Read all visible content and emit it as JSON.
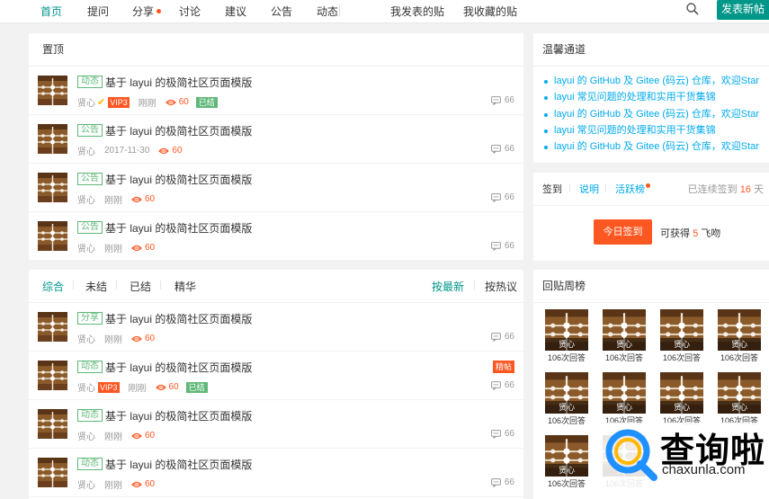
{
  "nav": {
    "items": [
      {
        "label": "首页",
        "active": true
      },
      {
        "label": "提问"
      },
      {
        "label": "分享",
        "dot": true
      },
      {
        "label": "讨论"
      },
      {
        "label": "建议"
      },
      {
        "label": "公告"
      },
      {
        "label": "动态"
      },
      {
        "label": "我发表的贴"
      },
      {
        "label": "我收藏的贴"
      }
    ],
    "search_icon": "search-icon",
    "post_button": "发表新帖"
  },
  "sticky_panel": {
    "title": "置顶",
    "posts": [
      {
        "tag": "动态",
        "title": "基于 layui 的极简社区页面模版",
        "author": "贤心",
        "verified": true,
        "vip": "VIP3",
        "time": "刚刚",
        "kiss": "60",
        "done": "已结",
        "replies": "66"
      },
      {
        "tag": "公告",
        "title": "基于 layui 的极简社区页面模版",
        "author": "贤心",
        "time": "2017-11-30",
        "kiss": "60",
        "replies": "66"
      },
      {
        "tag": "公告",
        "title": "基于 layui 的极简社区页面模版",
        "author": "贤心",
        "time": "刚刚",
        "kiss": "60",
        "replies": "66"
      },
      {
        "tag": "公告",
        "title": "基于 layui 的极简社区页面模版",
        "author": "贤心",
        "time": "刚刚",
        "kiss": "60",
        "replies": "66"
      }
    ]
  },
  "list_panel": {
    "filters": [
      "综合",
      "未结",
      "已结",
      "精华"
    ],
    "sorts": [
      "按最新",
      "按热议"
    ],
    "posts": [
      {
        "tag": "分享",
        "title": "基于 layui 的极简社区页面模版",
        "author": "贤心",
        "time": "刚刚",
        "kiss": "60",
        "replies": "66"
      },
      {
        "tag": "动态",
        "title": "基于 layui 的极简社区页面模版",
        "author": "贤心",
        "vip": "VIP3",
        "time": "刚刚",
        "kiss": "60",
        "done": "已结",
        "sticky": "精帖",
        "replies": "66"
      },
      {
        "tag": "动态",
        "title": "基于 layui 的极简社区页面模版",
        "author": "贤心",
        "time": "刚刚",
        "kiss": "60",
        "replies": "66"
      },
      {
        "tag": "动态",
        "title": "基于 layui 的极简社区页面模版",
        "author": "贤心",
        "time": "刚刚",
        "kiss": "60",
        "replies": "66"
      }
    ]
  },
  "links_panel": {
    "title": "温馨通道",
    "links": [
      "layui 的 GitHub 及 Gitee (码云) 仓库，欢迎Star",
      "layui 常见问题的处理和实用干货集锦",
      "layui 的 GitHub 及 Gitee (码云) 仓库，欢迎Star",
      "layui 常见问题的处理和实用干货集锦",
      "layui 的 GitHub 及 Gitee (码云) 仓库，欢迎Star"
    ]
  },
  "sign_panel": {
    "tabs": [
      "签到",
      "说明",
      "活跃榜"
    ],
    "streak_prefix": "已连续签到",
    "streak_days": "16",
    "streak_suffix": "天",
    "button": "今日签到",
    "reward_prefix": "可获得",
    "reward_amount": "5",
    "reward_suffix": "飞吻"
  },
  "rank_panel": {
    "title": "回贴周榜",
    "users": [
      {
        "name": "贤心",
        "count": "106次回答"
      },
      {
        "name": "贤心",
        "count": "106次回答"
      },
      {
        "name": "贤心",
        "count": "106次回答"
      },
      {
        "name": "贤心",
        "count": "106次回答"
      },
      {
        "name": "贤心",
        "count": "106次回答"
      },
      {
        "name": "贤心",
        "count": "106次回答"
      },
      {
        "name": "贤心",
        "count": "106次回答"
      },
      {
        "name": "贤心",
        "count": "106次回答"
      },
      {
        "name": "贤心",
        "count": "106次回答"
      },
      {
        "name": "贤心",
        "count": "106次回答"
      }
    ]
  },
  "watermark": {
    "cn": "查询啦",
    "en": "chaxunla.com"
  },
  "colors": {
    "brand": "#009688",
    "accent": "#ff5722",
    "link": "#01aaed",
    "tag": "#5fb878"
  }
}
